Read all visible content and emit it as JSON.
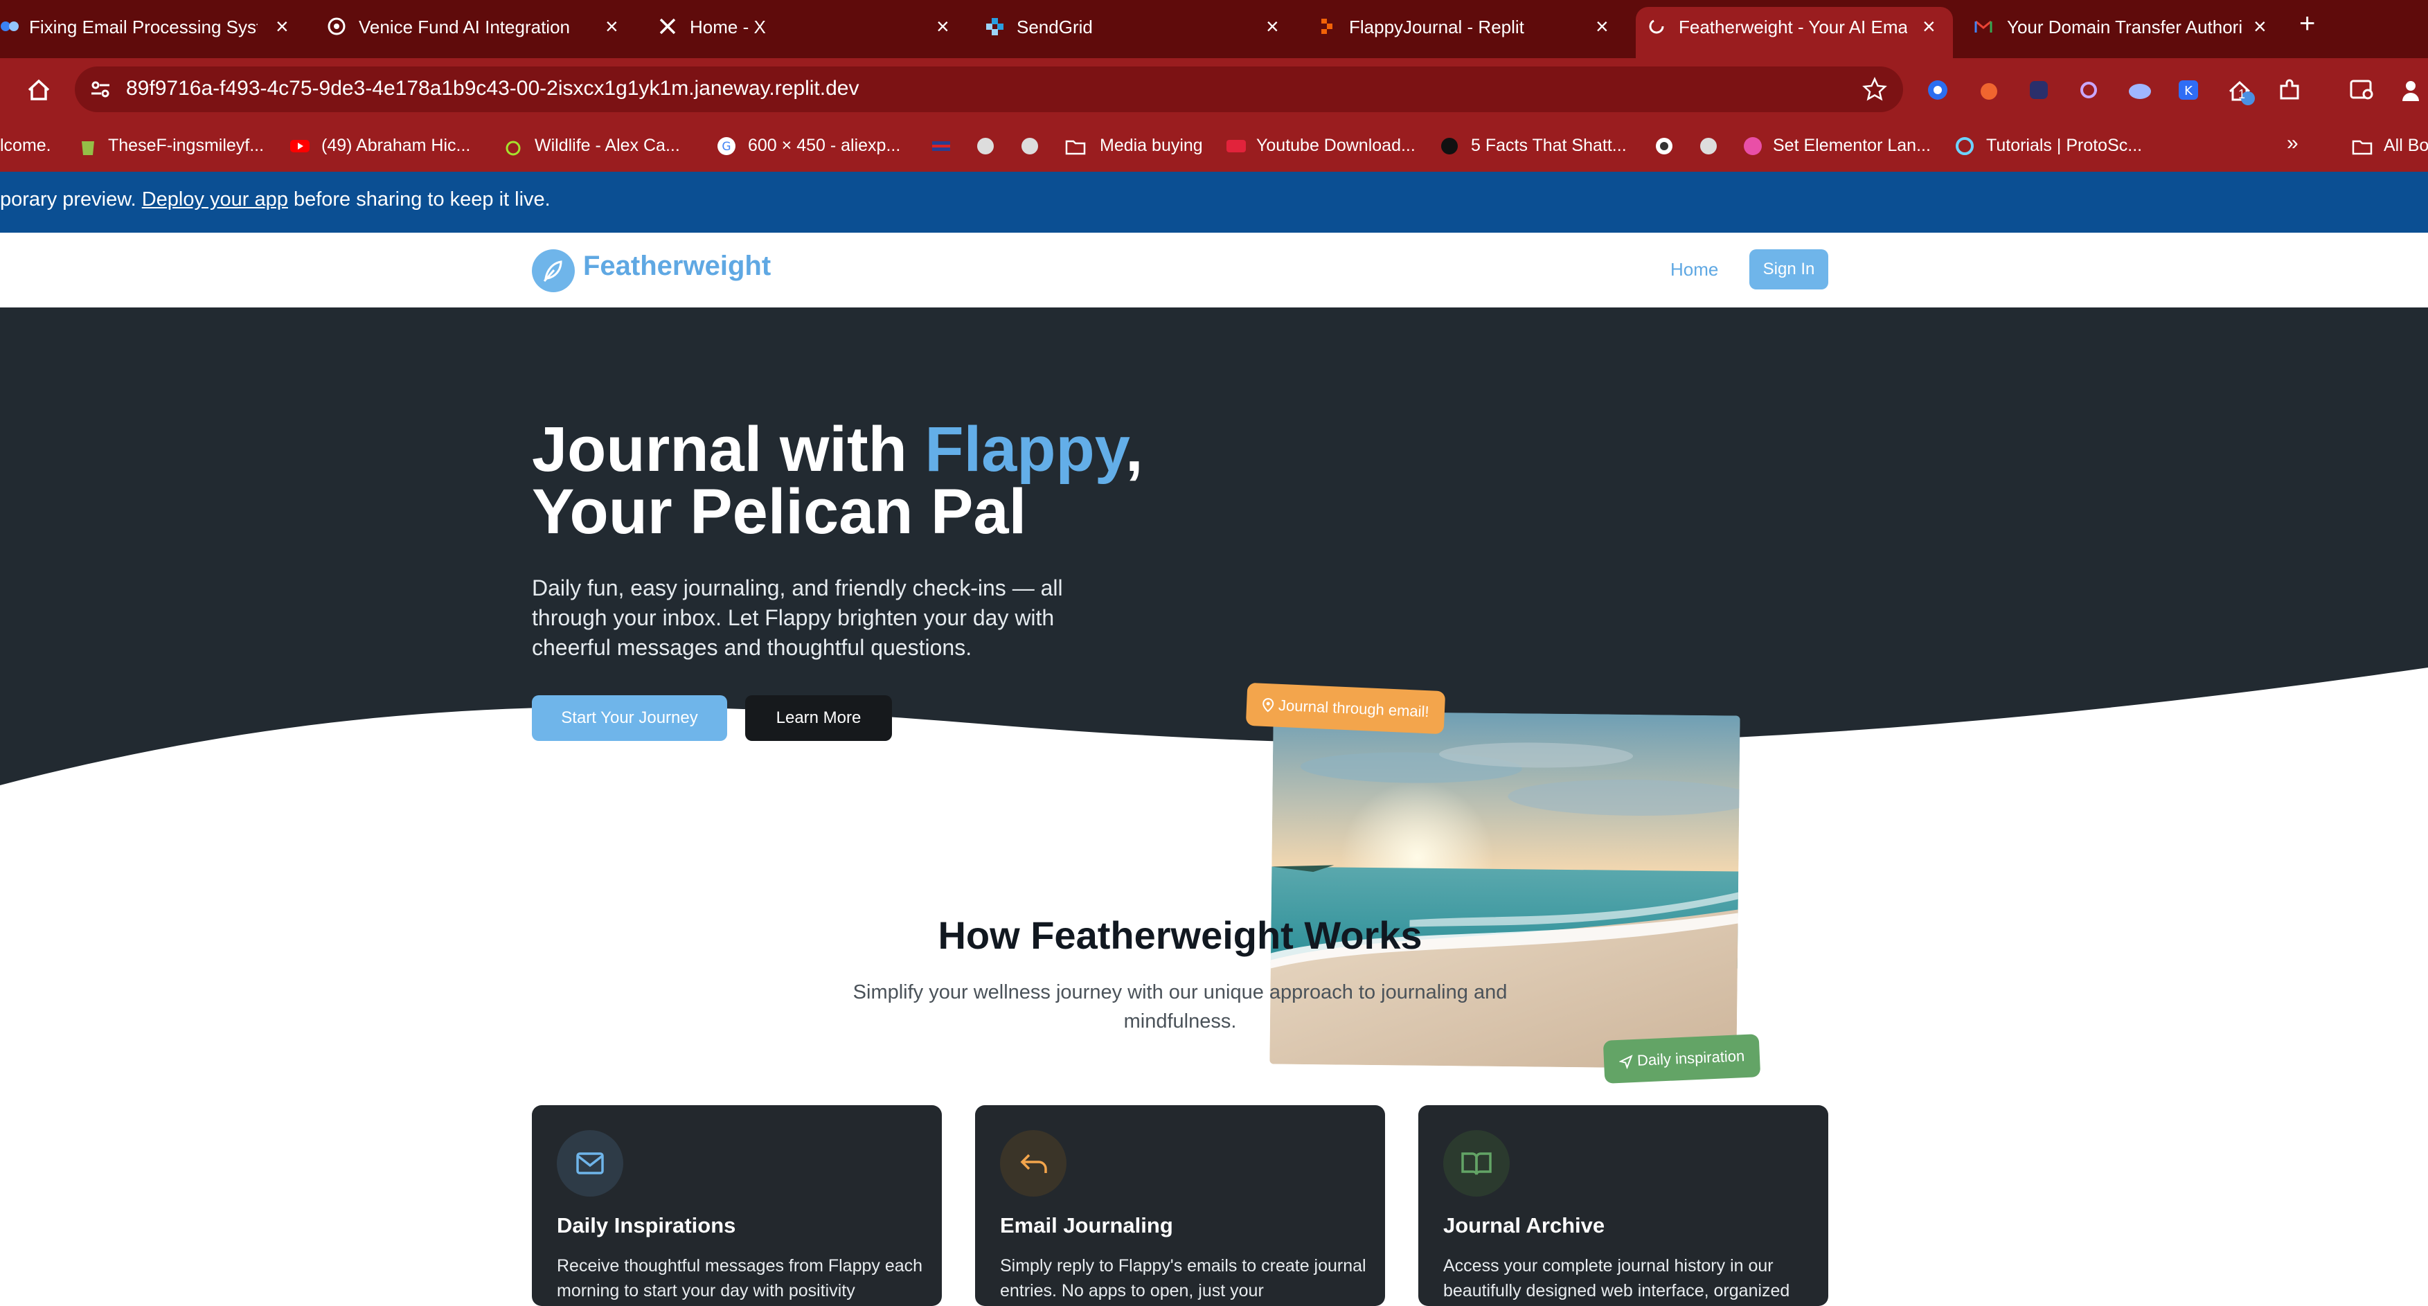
{
  "browser": {
    "tabs": [
      {
        "title": "Fixing Email Processing Syste",
        "favicon": "replit-agent-icon",
        "active": false
      },
      {
        "title": "Venice Fund AI Integration",
        "favicon": "openai-icon",
        "active": false
      },
      {
        "title": "Home - X",
        "favicon": "x-logo-icon",
        "active": false
      },
      {
        "title": "SendGrid",
        "favicon": "sendgrid-icon",
        "active": false
      },
      {
        "title": "FlappyJournal - Replit",
        "favicon": "replit-icon",
        "active": false
      },
      {
        "title": "Featherweight - Your AI Emai",
        "favicon": "loading-icon",
        "active": true
      },
      {
        "title": "Your Domain Transfer Authori",
        "favicon": "gmail-icon",
        "active": false
      }
    ],
    "url": "89f9716a-f493-4c75-9de3-4e178a1b9c43-00-2isxcx1g1yk1m.janeway.replit.dev",
    "bookmarks": [
      {
        "label": "lcome."
      },
      {
        "label": "TheseF-ingsmileyf..."
      },
      {
        "label": "(49) Abraham Hic..."
      },
      {
        "label": "Wildlife - Alex Ca..."
      },
      {
        "label": "600 × 450 - aliexp..."
      },
      {
        "label": "Media buying"
      },
      {
        "label": "Youtube Download..."
      },
      {
        "label": "5 Facts That Shatt..."
      },
      {
        "label": "Set Elementor Lan..."
      },
      {
        "label": "Tutorials | ProtoSc..."
      },
      {
        "label": "All Bo"
      }
    ],
    "extension_badge": "1"
  },
  "banner": {
    "prefix": "porary preview. ",
    "link": "Deploy your app",
    "suffix": " before sharing to keep it live."
  },
  "nav": {
    "brand": "Featherweight",
    "home": "Home",
    "signin": "Sign In"
  },
  "hero": {
    "title_part1": "Journal with ",
    "title_highlight": "Flappy",
    "title_part2": ",",
    "title_line2": "Your Pelican Pal",
    "subtitle": "Daily fun, easy journaling, and friendly check-ins — all through your inbox. Let Flappy brighten your day with cheerful messages and thoughtful questions.",
    "cta_primary": "Start Your Journey",
    "cta_secondary": "Learn More",
    "tag_email": "Journal through email!",
    "tag_inspire": "Daily inspiration"
  },
  "how": {
    "title": "How Featherweight Works",
    "subtitle": "Simplify your wellness journey with our unique approach to journaling and mindfulness.",
    "cards": [
      {
        "title": "Daily Inspirations",
        "body": "Receive thoughtful messages from Flappy each morning to start your day with positivity",
        "icon": "mail-icon",
        "accent": "#6fb5ea"
      },
      {
        "title": "Email Journaling",
        "body": "Simply reply to Flappy's emails to create journal entries. No apps to open, just your",
        "icon": "reply-icon",
        "accent": "#f3a54c"
      },
      {
        "title": "Journal Archive",
        "body": "Access your complete journal history in our beautifully designed web interface, organized",
        "icon": "book-open-icon",
        "accent": "#63a466"
      }
    ]
  },
  "colors": {
    "browser_frame": "#9a1d1f",
    "banner": "#0b4f93",
    "brand": "#5fa8e3",
    "hero_bg": "#222a31",
    "orange_accent": "#f3a54c",
    "green_accent": "#63a466"
  }
}
